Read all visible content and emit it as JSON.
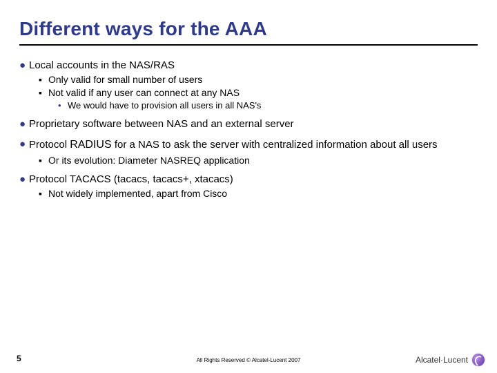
{
  "title": "Different ways for the AAA",
  "bullets": {
    "b1": "Local accounts in the NAS/RAS",
    "b1_1": "Only valid for small number of users",
    "b1_2": "Not valid if any user can connect at any NAS",
    "b1_2_1": "We would have to provision all users in all NAS's",
    "b2": "Proprietary software between NAS and an external server",
    "b3a": "Protocol ",
    "b3_radius": "RADIUS",
    "b3b": " for a NAS to ask the server with centralized information about all users",
    "b3_1": "Or its evolution: Diameter NASREQ application",
    "b4": "Protocol TACACS (tacacs, tacacs+, xtacacs)",
    "b4_1": "Not widely implemented, apart from Cisco"
  },
  "footer": {
    "page": "5",
    "copyright": "All Rights Reserved © Alcatel-Lucent 2007",
    "brand": "Alcatel·Lucent"
  }
}
